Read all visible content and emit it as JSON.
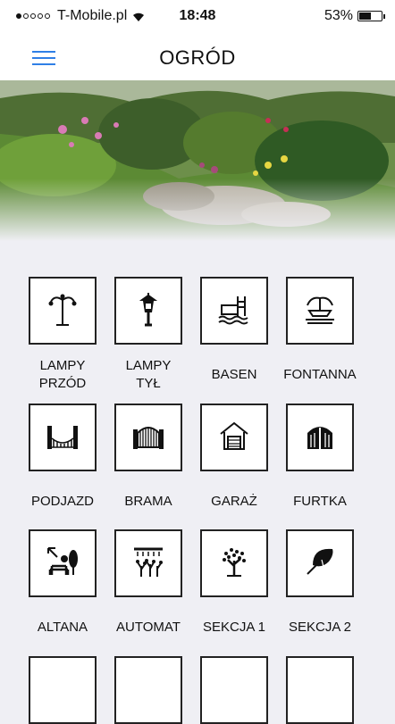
{
  "status": {
    "carrier": "T-Mobile.pl",
    "time": "18:48",
    "battery": "53%",
    "battery_level": 0.53
  },
  "header": {
    "title": "OGRÓD"
  },
  "tiles": [
    {
      "label1": "LAMPY",
      "label2": "PRZÓD",
      "icon": "street-lamp-icon"
    },
    {
      "label1": "LAMPY",
      "label2": "TYŁ",
      "icon": "wall-lantern-icon"
    },
    {
      "label1": "BASEN",
      "label2": "",
      "icon": "pool-icon"
    },
    {
      "label1": "FONTANNA",
      "label2": "",
      "icon": "fountain-icon"
    },
    {
      "label1": "PODJAZD",
      "label2": "",
      "icon": "driveway-gate-icon"
    },
    {
      "label1": "BRAMA",
      "label2": "",
      "icon": "gate-icon"
    },
    {
      "label1": "GARAŻ",
      "label2": "",
      "icon": "garage-icon"
    },
    {
      "label1": "FURTKA",
      "label2": "",
      "icon": "wicket-gate-icon"
    },
    {
      "label1": "ALTANA",
      "label2": "",
      "icon": "gazebo-icon"
    },
    {
      "label1": "AUTOMAT",
      "label2": "",
      "icon": "sprinkler-icon"
    },
    {
      "label1": "SEKCJA 1",
      "label2": "",
      "icon": "tree-icon"
    },
    {
      "label1": "SEKCJA 2",
      "label2": "",
      "icon": "leaf-icon"
    }
  ]
}
